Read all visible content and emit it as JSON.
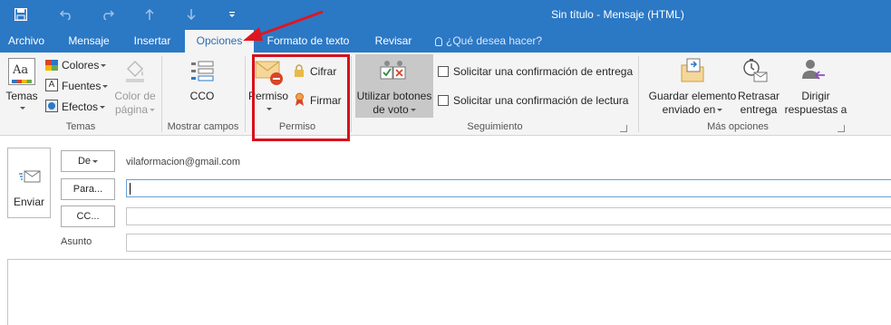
{
  "window": {
    "title": "Sin título - Mensaje (HTML)"
  },
  "quick_access": {
    "icons": [
      "save-icon",
      "undo-icon",
      "redo-icon",
      "up-arrow-icon",
      "down-arrow-icon",
      "customize-icon"
    ]
  },
  "tabs": [
    {
      "label": "Archivo"
    },
    {
      "label": "Mensaje"
    },
    {
      "label": "Insertar"
    },
    {
      "label": "Opciones",
      "active": true
    },
    {
      "label": "Formato de texto"
    },
    {
      "label": "Revisar"
    }
  ],
  "tell_me": {
    "label": "¿Qué desea hacer?",
    "icon": "lightbulb-icon"
  },
  "ribbon": {
    "temas": {
      "group_label": "Temas",
      "temas_button": "Temas",
      "colores": "Colores",
      "fuentes": "Fuentes",
      "efectos": "Efectos",
      "color_pagina_line1": "Color de",
      "color_pagina_line2": "página"
    },
    "mostrar": {
      "group_label": "Mostrar campos",
      "cco": "CCO"
    },
    "permiso": {
      "group_label": "Permiso",
      "permiso_button": "Permiso",
      "cifrar": "Cifrar",
      "firmar": "Firmar"
    },
    "seguimiento": {
      "group_label": "Seguimiento",
      "voto_line1": "Utilizar botones",
      "voto_line2": "de voto",
      "entrega": "Solicitar una confirmación de entrega",
      "lectura": "Solicitar una confirmación de lectura"
    },
    "mas_opciones": {
      "group_label": "Más opciones",
      "guardar_line1": "Guardar elemento",
      "guardar_line2": "enviado en",
      "retrasar_line1": "Retrasar",
      "retrasar_line2": "entrega",
      "dirigir_line1": "Dirigir",
      "dirigir_line2": "respuestas a"
    }
  },
  "compose": {
    "send": "Enviar",
    "from_button": "De",
    "from_value": "vilaformacion@gmail.com",
    "to_button": "Para...",
    "cc_button": "CC...",
    "subject_label": "Asunto",
    "to_value": "",
    "cc_value": "",
    "subject_value": "",
    "body_value": ""
  },
  "annotations": {
    "highlight_color": "#d8101b",
    "arrow_color": "#e0161e"
  },
  "colors": {
    "accent": "#2b78c5",
    "ribbon_bg": "#f4f4f4",
    "active_tab_text": "#2b6cb5"
  }
}
